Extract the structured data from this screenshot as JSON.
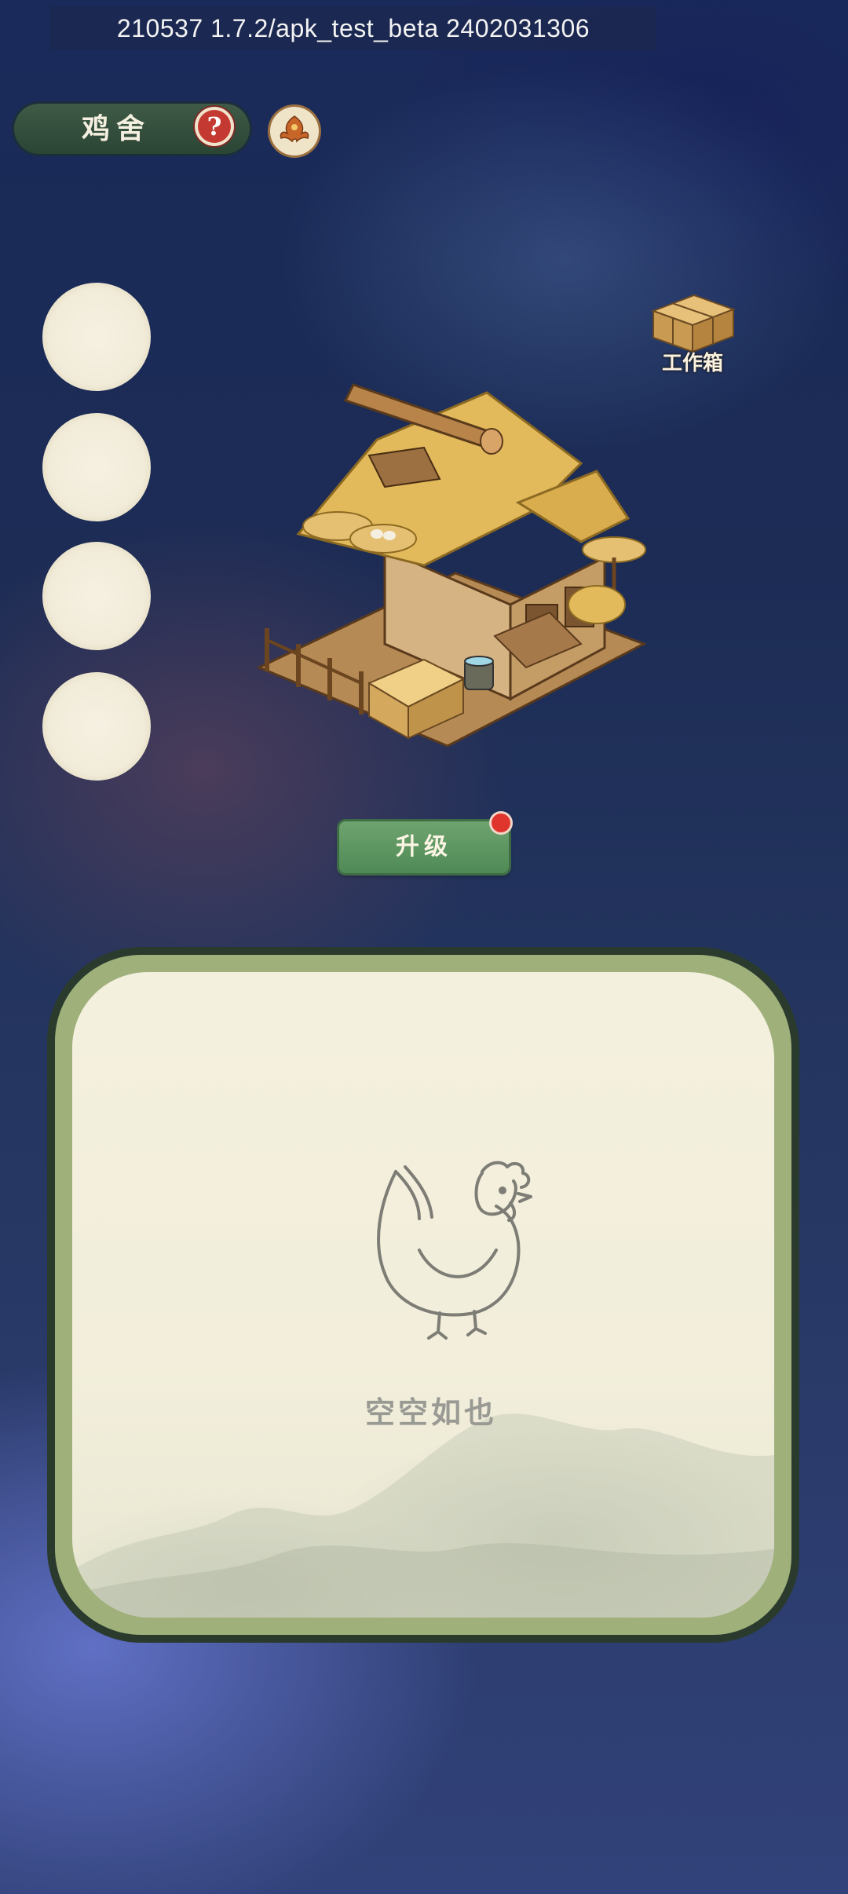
{
  "debug_bar": {
    "text": "210537  1.7.2/apk_test_beta  2402031306"
  },
  "header": {
    "title": "鸡舍",
    "help_icon": "question-mark-icon",
    "help_glyph": "?",
    "phoenix_icon": "phoenix-icon"
  },
  "side_slots": [
    {
      "state": "empty"
    },
    {
      "state": "empty"
    },
    {
      "state": "empty"
    },
    {
      "state": "empty"
    }
  ],
  "workbox": {
    "label": "工作箱",
    "icon": "crate-icon"
  },
  "building": {
    "icon": "chicken-coop-building"
  },
  "upgrade": {
    "label": "升级",
    "has_notification": true
  },
  "panel": {
    "empty_text": "空空如也",
    "icon": "chicken-icon"
  },
  "colors": {
    "accent_green": "#5b9660",
    "notification_red": "#e0352d",
    "panel_paper": "#f2eedb",
    "panel_border": "#9fb07a",
    "title_pill": "#34503e"
  }
}
